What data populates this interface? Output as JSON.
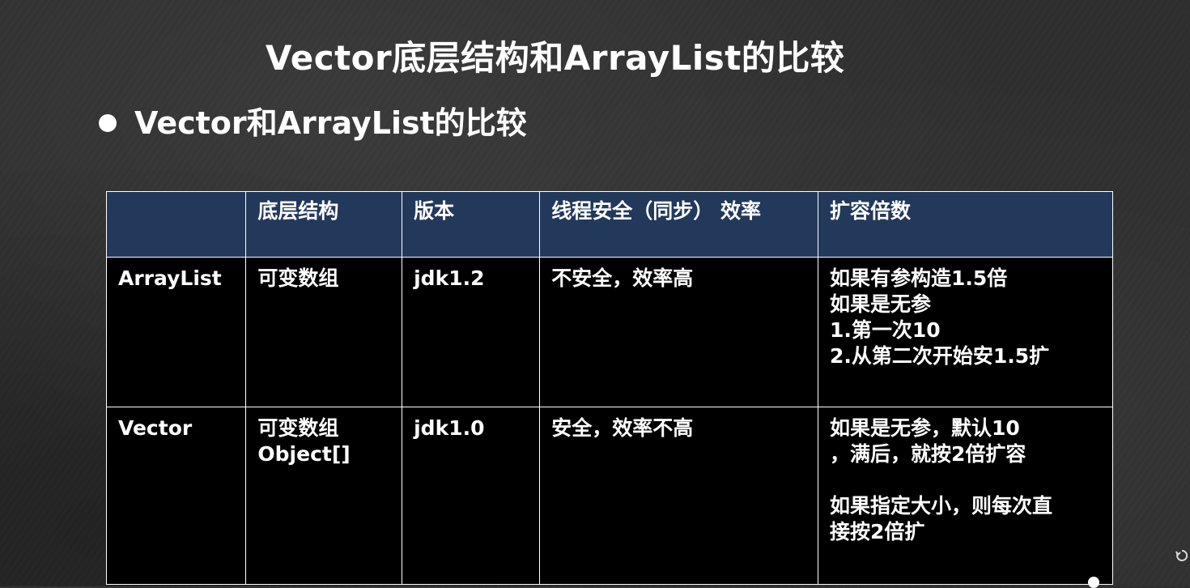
{
  "slide": {
    "title": "Vector底层结构和ArrayList的比较",
    "bullet": "Vector和ArrayList的比较"
  },
  "table": {
    "headers": [
      "",
      "底层结构",
      "版本",
      "线程安全（同步） 效率",
      "扩容倍数"
    ],
    "rows": [
      [
        "ArrayList",
        "可变数组",
        "jdk1.2",
        "不安全，效率高",
        "如果有参构造1.5倍\n如果是无参\n1.第一次10\n2.从第二次开始安1.5扩"
      ],
      [
        "Vector",
        "可变数组\nObject[]",
        "jdk1.0",
        "安全，效率不高",
        "如果是无参，默认10\n，满后，就按2倍扩容\n\n如果指定大小，则每次直\n接按2倍扩"
      ]
    ]
  },
  "colors": {
    "background": "#2e2e2e",
    "header_fill": "#23395b",
    "body_fill": "#000000",
    "text": "#ffffff"
  },
  "icons": {
    "bullet": "bullet-dot",
    "side": "rotate-icon"
  }
}
